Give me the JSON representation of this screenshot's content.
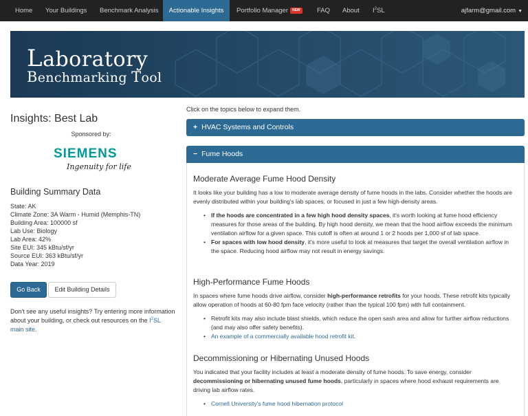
{
  "nav": {
    "home": "Home",
    "buildings": "Your Buildings",
    "benchmark": "Benchmark Analysis",
    "actionable": "Actionable Insights",
    "portfolio": "Portfolio Manager",
    "portfolio_badge": "NEW",
    "faq": "FAQ",
    "about": "About",
    "i2sl_pre": "I",
    "i2sl_sup": "2",
    "i2sl_post": "SL",
    "user": "ajfarm@gmail.com",
    "active_color": "#2d6a93"
  },
  "banner": {
    "line1_cap": "L",
    "line1_rest": "aboratory",
    "line2_cap1": "B",
    "line2_rest1": "enchmarking ",
    "line2_cap2": "T",
    "line2_rest2": "ool"
  },
  "sidebar": {
    "insights_title": "Insights: Best Lab",
    "sponsored_by": "Sponsored by:",
    "sponsor_name": "SIEMENS",
    "sponsor_tagline": "Ingenuity for life",
    "summary_title": "Building Summary Data",
    "summary_rows": [
      "State: AK",
      "Climate Zone: 3A Warm - Humid (Memphis-TN)",
      "Building Area: 100000 sf",
      "Lab Use: Biology",
      "Lab Area: 42%",
      "Site EUI: 345 kBtu/sf/yr",
      "Source EUI: 363 kBtu/sf/yr",
      "Data Year: 2019"
    ],
    "go_back": "Go Back",
    "edit_details": "Edit Building Details",
    "note_text": "Don't see any useful insights? Try entering more information about your building, or check out resources on the ",
    "note_link_pre": "I",
    "note_link_sup": "2",
    "note_link_post": "SL main site",
    "note_end": "."
  },
  "main": {
    "expand_hint": "Click on the topics below to expand them.",
    "panels": [
      {
        "icon": "+",
        "title": "HVAC Systems and Controls",
        "state": "collapsed"
      },
      {
        "icon": "−",
        "title": "Fume Hoods",
        "state": "expanded"
      }
    ],
    "s1": {
      "title": "Moderate Average Fume Hood Density",
      "intro": "It looks like your building has a low to moderate average density of fume hoods in the labs. Consider whether the hoods are evenly distributed within your building's lab spaces, or focused in just a few high-density areas.",
      "b1_bold": "If the hoods are concentrated in a few high hood density spaces",
      "b1_rest": ", it's worth looking at fume hood efficiency measures for those areas of the building. By high hood density, we mean that the hood airflow exceeds the minimum ventilation airflow for a given space. This cutoff is often at around 1 or 2 hoods per 1,000 sf of lab space.",
      "b2_bold": "For spaces with low hood density",
      "b2_rest": ", it's more useful to look at measures that target the overall ventilation airflow in the space. Reducing hood airflow may not result in energy savings."
    },
    "s2": {
      "title": "High-Performance Fume Hoods",
      "intro_pre": "In spaces where fume hoods drive airflow, consider ",
      "intro_bold": "high-performance retrofits",
      "intro_post": " for your hoods. These retrofit kits typically allow operation of hoods at 60-80 fpm face velocity (rather than the typical 100 fpm) with full containment.",
      "b1": "Retrofit kits may also include blast shields, which reduce the open sash area and allow for further airflow reductions (and may also offer safety benefits).",
      "b2_link": "An example of a commercially available hood retrofit kit",
      "b2_end": "."
    },
    "s3": {
      "title": "Decommissioning or Hibernating Unused Hoods",
      "intro_pre": "You indicated that your facility includes at least a moderate density of fume hoods. To save energy, consider ",
      "intro_bold": "decommissioning or hibernating unused fume hoods",
      "intro_post": ", particularly in spaces where hood exhaust requirements are driving lab airflow rates.",
      "b1_link": "Cornell University's fume hood hibernation protocol"
    }
  }
}
